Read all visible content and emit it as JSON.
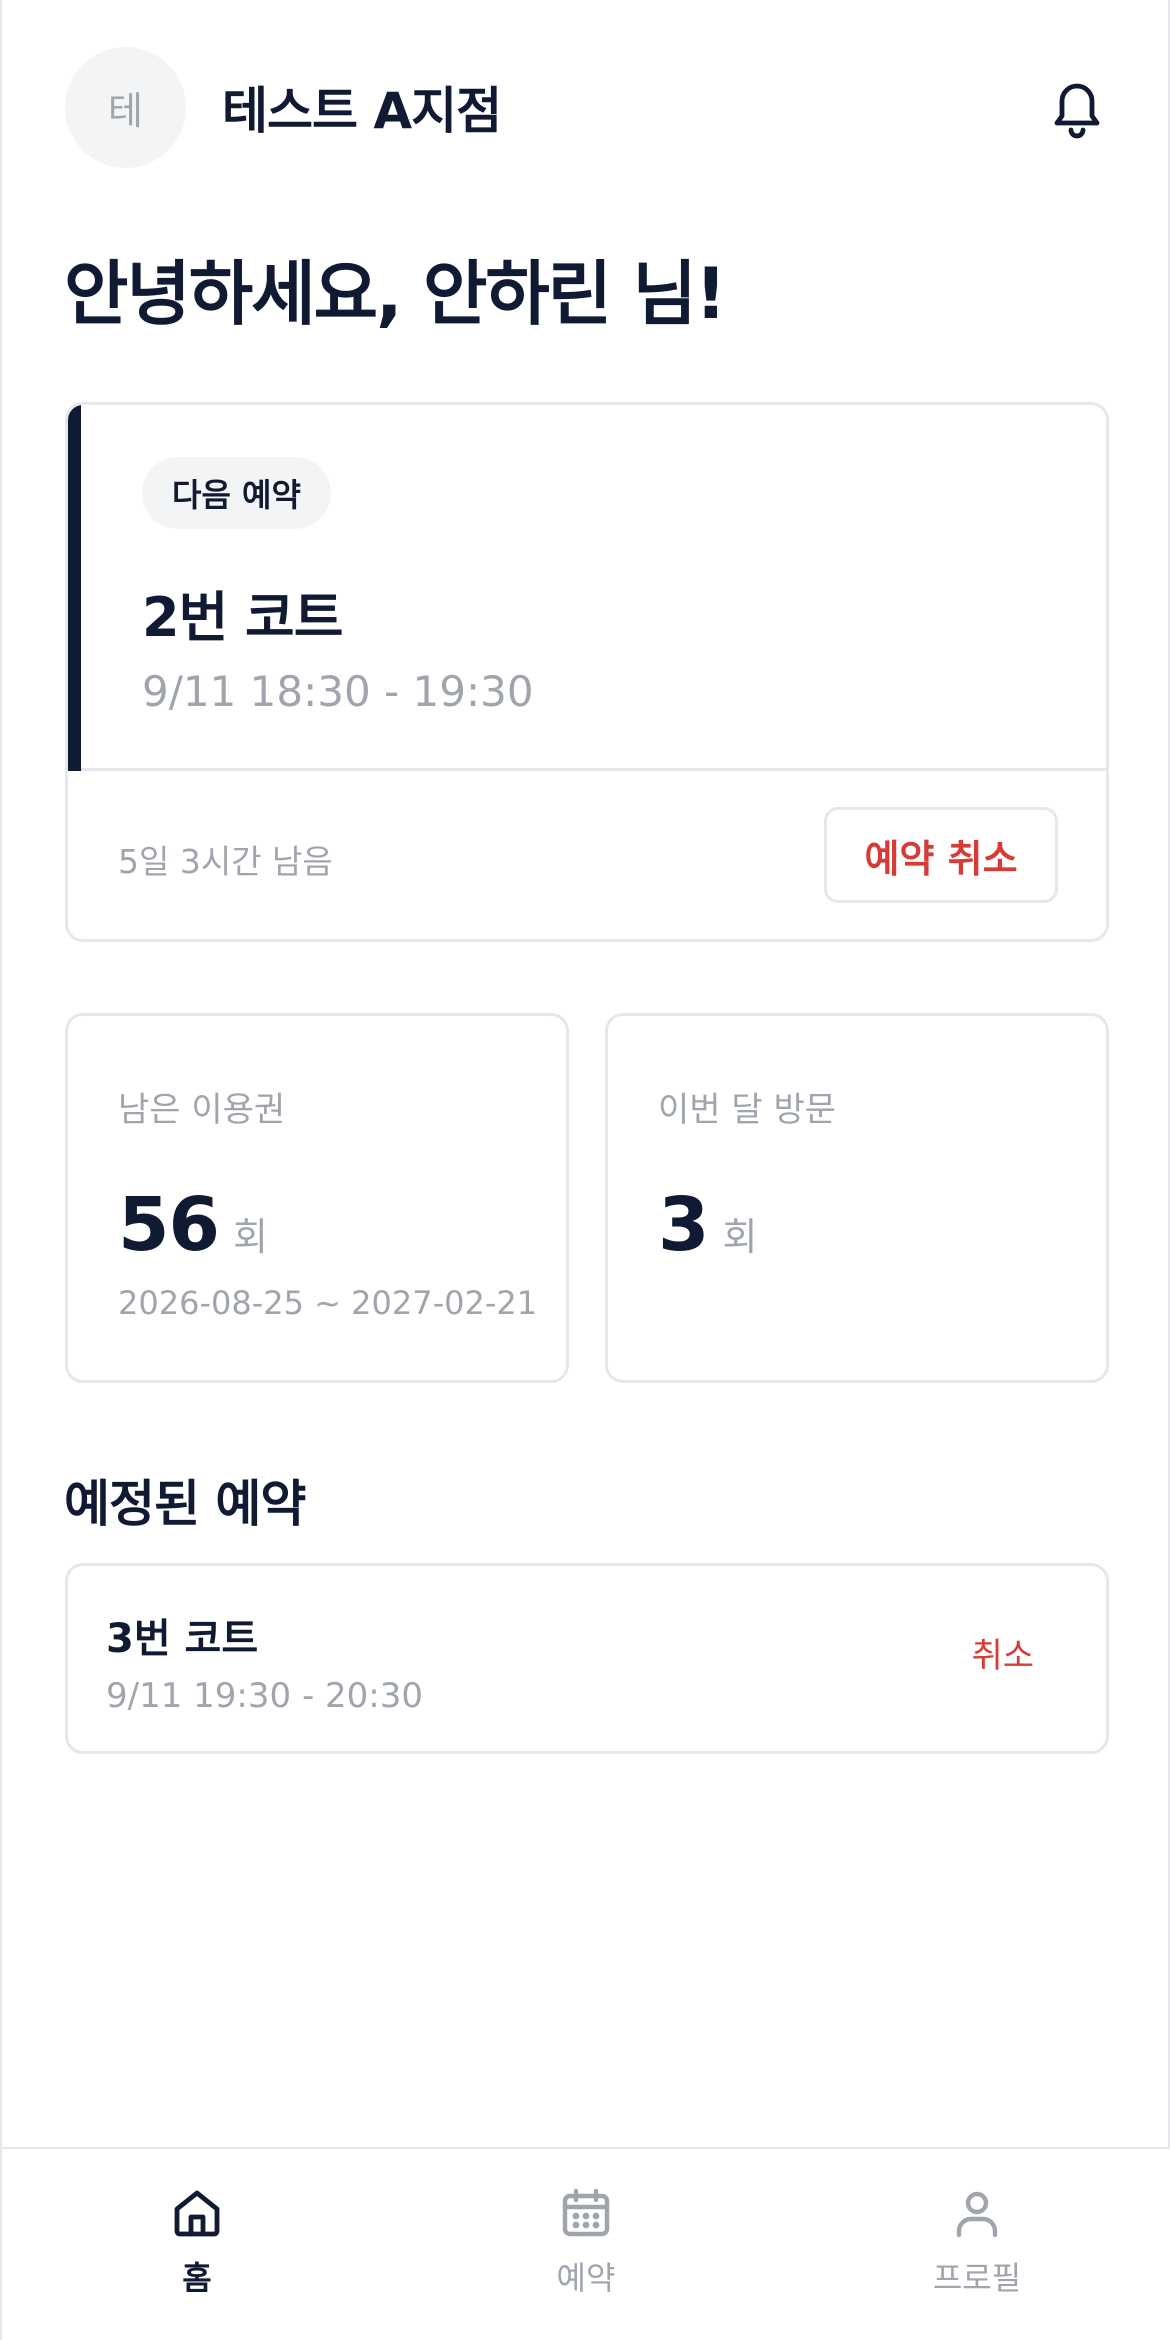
{
  "header": {
    "avatar_initial": "테",
    "branch_name": "테스트 A지점",
    "bell_icon": "bell-icon"
  },
  "greeting": "안녕하세요, 안하린 님!",
  "next_reservation": {
    "badge": "다음 예약",
    "court": "2번 코트",
    "time": "9/11 18:30 - 19:30",
    "remaining": "5일 3시간 남음",
    "cancel_label": "예약 취소"
  },
  "stats": {
    "passes": {
      "label": "남은 이용권",
      "value": "56",
      "unit": "회",
      "range": "2026-08-25 ~ 2027-02-21"
    },
    "visits": {
      "label": "이번 달 방문",
      "value": "3",
      "unit": "회"
    }
  },
  "scheduled": {
    "title": "예정된 예약",
    "items": [
      {
        "court": "3번 코트",
        "time": "9/11 19:30 - 20:30",
        "cancel_label": "취소"
      }
    ]
  },
  "bottom_nav": {
    "items": [
      {
        "label": "홈",
        "icon": "home-icon",
        "active": true
      },
      {
        "label": "예약",
        "icon": "calendar-icon",
        "active": false
      },
      {
        "label": "프로필",
        "icon": "user-icon",
        "active": false
      }
    ]
  },
  "colors": {
    "primary": "#111a33",
    "muted": "#a0a4ad",
    "danger": "#d63b36",
    "border": "#e6e7ea",
    "chip_bg": "#f3f4f6"
  }
}
